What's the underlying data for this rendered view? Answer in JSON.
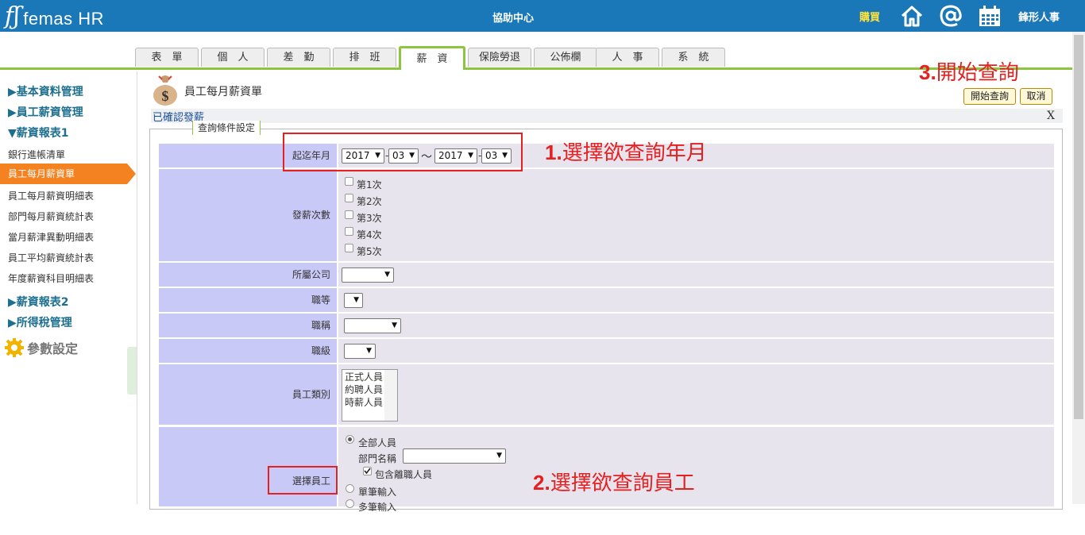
{
  "header": {
    "logo_mark": "fʃ",
    "logo_text": "femas HR",
    "center_title": "協助中心",
    "buy_label": "購買",
    "user_name": "鋒形人事",
    "icons": [
      "home-icon",
      "at-icon",
      "calendar-icon"
    ]
  },
  "tabs": [
    {
      "label": "表　單"
    },
    {
      "label": "個　人"
    },
    {
      "label": "差　勤"
    },
    {
      "label": "排　班"
    },
    {
      "label": "薪　資",
      "active": true
    },
    {
      "label": "保險勞退"
    },
    {
      "label": "公佈欄"
    },
    {
      "label": "人　事"
    },
    {
      "label": "系　統"
    }
  ],
  "sidebar": {
    "sections": [
      {
        "label": "▶基本資料管理"
      },
      {
        "label": "▶員工薪資管理"
      },
      {
        "label": "▼薪資報表1"
      }
    ],
    "items": [
      "銀行進帳清單",
      "員工每月薪資單",
      "員工每月薪資明細表",
      "部門每月薪資統計表",
      "當月薪津異動明細表",
      "員工平均薪資統計表",
      "年度薪資科目明細表"
    ],
    "active_item": "員工每月薪資單",
    "sections_after": [
      {
        "label": "▶薪資報表2"
      },
      {
        "label": "▶所得稅管理"
      }
    ],
    "param_label": "參數設定"
  },
  "page": {
    "title": "員工每月薪資單",
    "status": "已確認發薪",
    "close": "X",
    "buttons": {
      "query": "開始查詢",
      "cancel": "取消"
    },
    "legend": "查詢條件設定"
  },
  "form": {
    "period": {
      "label": "起迄年月",
      "start_year": "2017",
      "start_month": "03",
      "sep": "～",
      "end_year": "2017",
      "end_month": "03"
    },
    "pay_count": {
      "label": "發薪次數",
      "options": [
        "第1次",
        "第2次",
        "第3次",
        "第4次",
        "第5次"
      ]
    },
    "company": {
      "label": "所屬公司",
      "value": ""
    },
    "rank": {
      "label": "職等",
      "value": ""
    },
    "title_field": {
      "label": "職稱",
      "value": ""
    },
    "grade": {
      "label": "職級",
      "value": ""
    },
    "emp_type": {
      "label": "員工類別",
      "options": [
        "正式人員",
        "約聘人員",
        "時薪人員"
      ]
    },
    "employee": {
      "label": "選擇員工",
      "all_label": "全部人員",
      "dept_label": "部門名稱",
      "include_resigned": "包含離職人員",
      "single_label": "單筆輸入",
      "multi_label": "多筆輸入"
    }
  },
  "annotations": {
    "a1": {
      "num": "1.",
      "text": "選擇欲查詢年月"
    },
    "a2": {
      "num": "2.",
      "text": "選擇欲查詢員工"
    },
    "a3": {
      "num": "3.",
      "text": "開始查詢"
    }
  },
  "colors": {
    "header_bg": "#1a78b8",
    "tab_active": "#8cc63f",
    "sidebar_active": "#f58220",
    "label_bg": "#c9c9f7",
    "annotation": "#e52020"
  }
}
